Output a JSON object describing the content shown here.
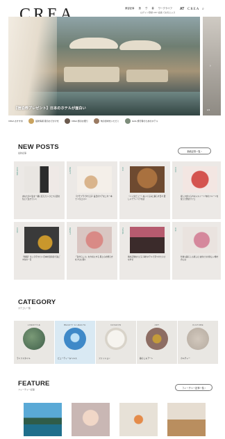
{
  "header": {
    "logo": "CREA",
    "nav": [
      "美容記事",
      "旅",
      "ヴ",
      "暮",
      "ワークライフ"
    ],
    "subnav": "ログイン登録 ANY 会員 でお気に入り",
    "badge_at": "AT",
    "badge_crea": "CREA",
    "search_glyph": "⌕"
  },
  "hero": {
    "caption": "【宿泊券プレゼント】日本のホテルが面白い",
    "side_arrow": "›",
    "side_num": "1/3"
  },
  "ticker": {
    "lead": "CREA おすすめ",
    "items": [
      "最新情報 夏のおでかけを",
      "CREA 旅のお便り",
      "旬の食材をいただく",
      "Hello 旅行者のためのホテル"
    ]
  },
  "new_posts": {
    "title": "NEW POSTS",
    "subtitle": "最新記事",
    "more": "新着記事一覧 ›",
    "cards": [
      {
        "cat": "CULTURE",
        "text": "あなたの人生を一緒に変えたい ひとつ言葉を信じて生きていく"
      },
      {
        "cat": "BEAUTY",
        "text": "【プチプラで叶える】毎日のケアをこれ一本で 人気コスメ"
      },
      {
        "cat": "LIFE",
        "text": "〈インタビュー〉ぬいぐるみと暮らす日々 愛しいテディベアの話"
      },
      {
        "cat": "FOOD",
        "text": "夏しか食べられないスイーツ 旬のフルーツを使った贅沢パフェ"
      },
      {
        "cat": "FOOD",
        "text": "【特集】今こそ行きたい 日本の温泉宿で過ごす冬の一日"
      },
      {
        "cat": "BEAUTY",
        "text": "「自分らしさ」を大切にする 肌と心の整え方をプロに聞く"
      },
      {
        "cat": "TRAVEL",
        "text": "旅の記憶をたどる 海外ホテルで見つけた小さな幸せ"
      },
      {
        "cat": "LIFE",
        "text": "仕事も暮らしも楽しむ 女性たちの新しい働き方とは"
      }
    ]
  },
  "category": {
    "title": "CATEGORY",
    "subtitle": "カテゴリ一覧",
    "items": [
      {
        "en": "LIFESTYLE",
        "jp": "ライフスタイル",
        "color": "#3f5f4a"
      },
      {
        "en": "BEAUTY & HEALTH",
        "jp": "ビューティー＆ヘルス",
        "color": "#3f89c8"
      },
      {
        "en": "FASHION",
        "jp": "ファッション",
        "color": "#e9e6de"
      },
      {
        "en": "ART",
        "jp": "暮らし＆アート",
        "color": "#8d6d63"
      },
      {
        "en": "CULTURE",
        "jp": "カルチャー",
        "color": "#b5aba0"
      }
    ]
  },
  "feature": {
    "title": "FEATURE",
    "subtitle": "フィーチャー記事",
    "more": "フィーチャー記事一覧 ›"
  }
}
